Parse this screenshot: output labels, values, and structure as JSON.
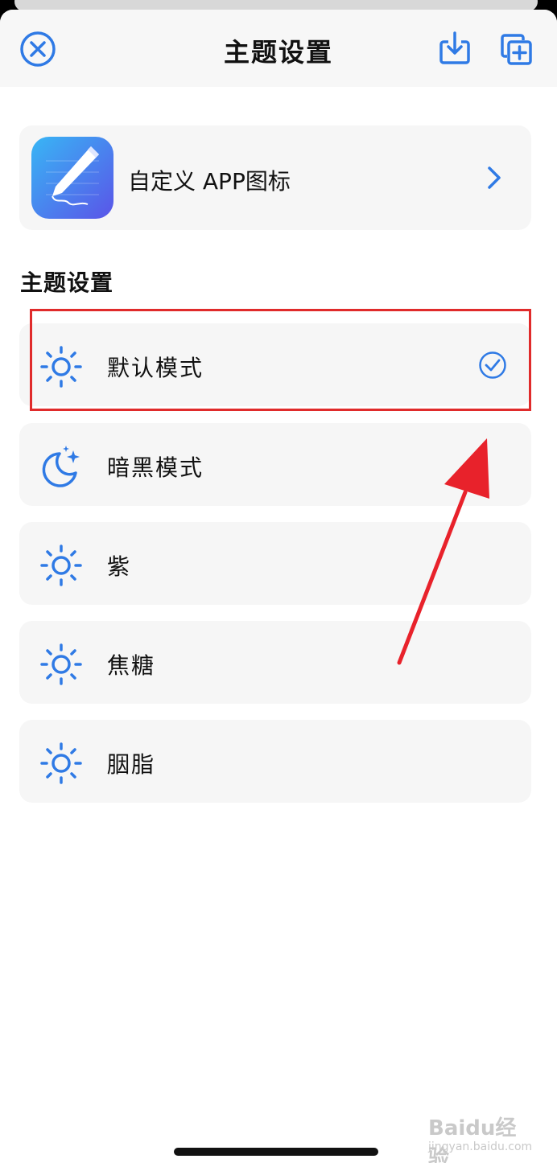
{
  "header": {
    "title": "主题设置",
    "close_icon": "close-circle-icon",
    "download_icon": "download-icon",
    "copy_icon": "copy-add-icon"
  },
  "app_icon_card": {
    "label": "自定义 APP图标",
    "icon": "pen-app-icon",
    "chevron": "chevron-right-icon"
  },
  "section": {
    "title": "主题设置"
  },
  "themes": [
    {
      "label": "默认模式",
      "icon": "sun-icon",
      "selected": true
    },
    {
      "label": "暗黑模式",
      "icon": "moon-stars-icon",
      "selected": false
    },
    {
      "label": "紫",
      "icon": "sun-icon",
      "selected": false
    },
    {
      "label": "焦糖",
      "icon": "sun-icon",
      "selected": false
    },
    {
      "label": "胭脂",
      "icon": "sun-icon",
      "selected": false
    }
  ],
  "watermark": {
    "logo": "Baidu经验",
    "url": "jingyan.baidu.com"
  },
  "colors": {
    "accent": "#2f7ae5",
    "annotation_red": "#e02b2b",
    "card_bg": "#f6f6f6",
    "header_bg": "#f7f7f7"
  }
}
